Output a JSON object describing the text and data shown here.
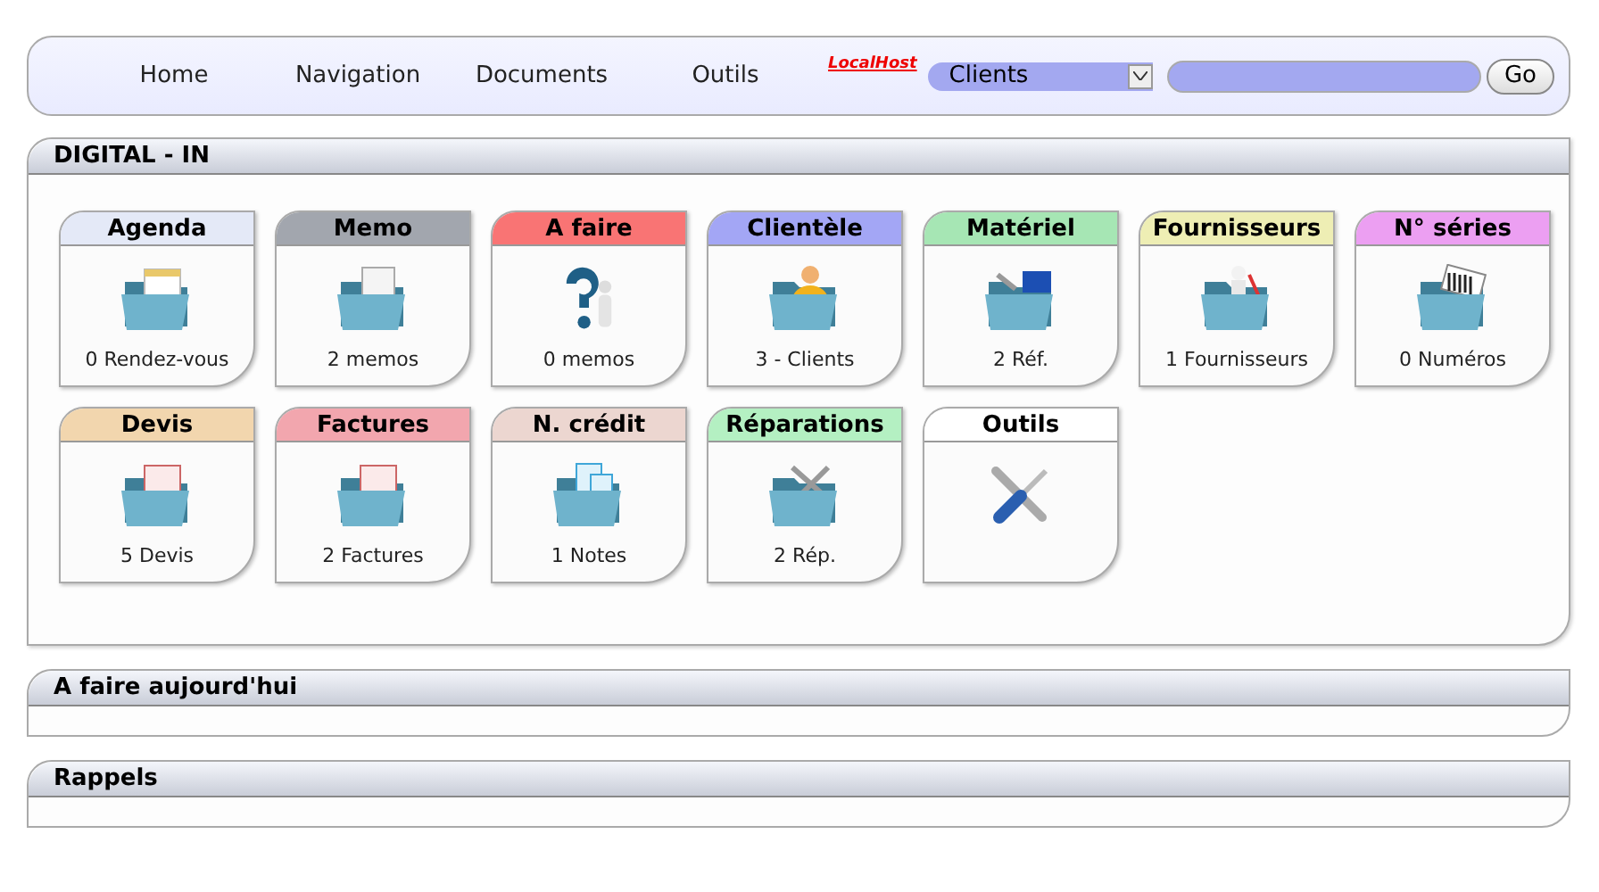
{
  "nav": {
    "links": [
      "Home",
      "Navigation",
      "Documents",
      "Outils"
    ],
    "logo": "LocalHost",
    "select": {
      "value": "Clients"
    },
    "go": "Go"
  },
  "main_panel": {
    "title": "DIGITAL - IN",
    "tiles": [
      {
        "title": "Agenda",
        "color": "#e4e9f7",
        "caption": "0 Rendez-vous"
      },
      {
        "title": "Memo",
        "color": "#a2a6ae",
        "caption": "2 memos"
      },
      {
        "title": "A faire",
        "color": "#f97474",
        "caption": "0 memos"
      },
      {
        "title": "Clientèle",
        "color": "#a3a6f5",
        "caption": "3 - Clients"
      },
      {
        "title": "Matériel",
        "color": "#a6e6b4",
        "caption": "2 Réf."
      },
      {
        "title": "Fournisseurs",
        "color": "#eeeeb4",
        "caption": "1 Fournisseurs"
      },
      {
        "title": "N° séries",
        "color": "#ec9ff2",
        "caption": "0 Numéros"
      },
      {
        "title": "Devis",
        "color": "#f2d6ae",
        "caption": "5 Devis"
      },
      {
        "title": "Factures",
        "color": "#f2a6ae",
        "caption": "2 Factures"
      },
      {
        "title": "N. crédit",
        "color": "#ecd6d0",
        "caption": "1 Notes"
      },
      {
        "title": "Réparations",
        "color": "#b4f0c2",
        "caption": "2 Rép."
      },
      {
        "title": "Outils",
        "color": "#ffffff"
      }
    ]
  },
  "sections": [
    {
      "title": "A faire aujourd'hui"
    },
    {
      "title": "Rappels"
    }
  ]
}
